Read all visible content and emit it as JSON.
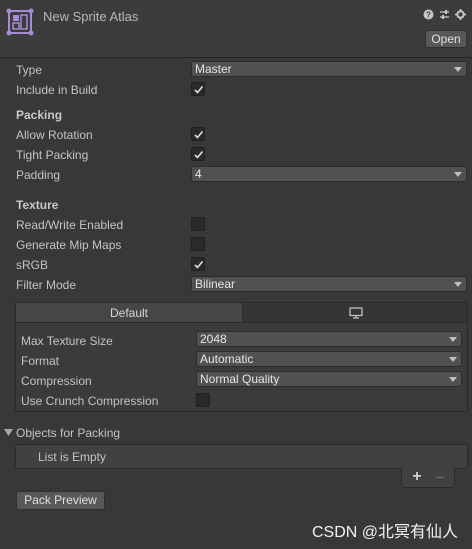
{
  "header": {
    "title": "New Sprite Atlas",
    "open_label": "Open",
    "icons": [
      "help-icon",
      "preset-icon",
      "settings-icon"
    ]
  },
  "fields": {
    "type_label": "Type",
    "type_value": "Master",
    "include_in_build_label": "Include in Build",
    "include_in_build": true
  },
  "packing": {
    "section": "Packing",
    "allow_rotation_label": "Allow Rotation",
    "allow_rotation": true,
    "tight_packing_label": "Tight Packing",
    "tight_packing": true,
    "padding_label": "Padding",
    "padding_value": "4"
  },
  "texture": {
    "section": "Texture",
    "read_write_label": "Read/Write Enabled",
    "read_write": false,
    "mipmaps_label": "Generate Mip Maps",
    "mipmaps": false,
    "srgb_label": "sRGB",
    "srgb": true,
    "filter_mode_label": "Filter Mode",
    "filter_mode_value": "Bilinear"
  },
  "platform": {
    "tab_default": "Default",
    "tab_standalone_icon": "monitor-icon",
    "max_size_label": "Max Texture Size",
    "max_size_value": "2048",
    "format_label": "Format",
    "format_value": "Automatic",
    "compression_label": "Compression",
    "compression_value": "Normal Quality",
    "crunch_label": "Use Crunch Compression",
    "crunch": false
  },
  "objects": {
    "section": "Objects for Packing",
    "empty_text": "List is Empty",
    "add_label": "+",
    "remove_label": "−"
  },
  "pack_preview_label": "Pack Preview",
  "watermark": "CSDN @北冥有仙人",
  "colors": {
    "background": "#383838",
    "accent_icon": "#a58bd8"
  }
}
